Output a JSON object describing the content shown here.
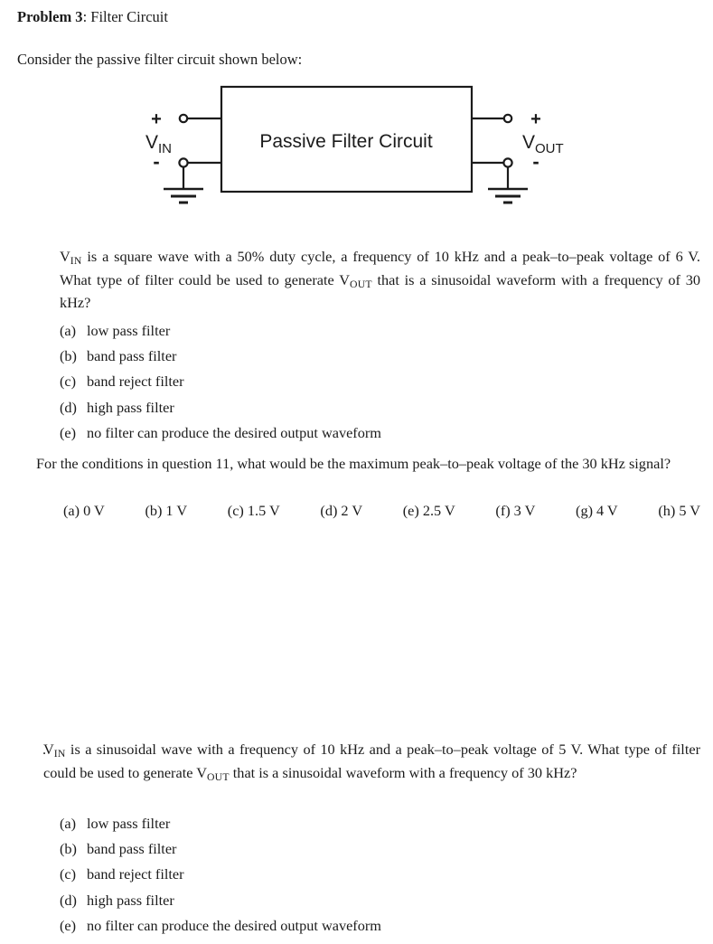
{
  "document": {
    "heading": {
      "bold_part": "Problem 3",
      "rest": ": Filter Circuit"
    },
    "intro": "Consider the passive filter circuit shown below:"
  },
  "diagram": {
    "box_label": "Passive Filter Circuit",
    "input": {
      "plus": "+",
      "minus": "-",
      "name_main": "V",
      "name_sub": "IN"
    },
    "output": {
      "plus": "+",
      "minus": "-",
      "name_main": "V",
      "name_sub": "OUT"
    },
    "colors": {
      "line": "#1b1b1b",
      "fill": "#ffffff"
    }
  },
  "questions": [
    {
      "marker": "",
      "text_parts": {
        "p1_a": "V",
        "p1_sub": "IN",
        "p1_b": " is a square wave with a 50% duty cycle, a frequency of 10 kHz and a peak–to–peak voltage of 6 V. What type of filter could be used to generate ",
        "p1_c": "V",
        "p1_sub2": "OUT",
        "p1_d": " that is a sinusoidal waveform with a frequency of 30 kHz?"
      },
      "choices": [
        {
          "label": "(a)",
          "text": "low pass filter"
        },
        {
          "label": "(b)",
          "text": "band pass filter"
        },
        {
          "label": "(c)",
          "text": "band reject filter"
        },
        {
          "label": "(d)",
          "text": "high pass filter"
        },
        {
          "label": "(e)",
          "text": "no filter can produce the desired output waveform"
        }
      ]
    },
    {
      "marker": "",
      "text": "For the conditions in question 11, what would be the maximum peak–to–peak voltage of the 30 kHz signal?",
      "inline_choices": [
        {
          "label": "(a)",
          "text": "0 V"
        },
        {
          "label": "(b)",
          "text": "1 V"
        },
        {
          "label": "(c)",
          "text": "1.5 V"
        },
        {
          "label": "(d)",
          "text": "2 V"
        },
        {
          "label": "(e)",
          "text": "2.5 V"
        },
        {
          "label": "(f)",
          "text": "3 V"
        },
        {
          "label": "(g)",
          "text": "4 V"
        },
        {
          "label": "(h)",
          "text": "5 V"
        }
      ]
    },
    {
      "marker": ".",
      "text_parts": {
        "p3_a": "V",
        "p3_sub": "IN",
        "p3_b": " is a sinusoidal wave with a frequency of 10 kHz and a peak–to–peak voltage of 5 V. What type of filter could be used to generate ",
        "p3_c": "V",
        "p3_sub2": "OUT",
        "p3_d": " that is a sinusoidal waveform with a frequency of 30 kHz?"
      },
      "choices": [
        {
          "label": "(a)",
          "text": "low pass filter"
        },
        {
          "label": "(b)",
          "text": "band pass filter"
        },
        {
          "label": "(c)",
          "text": "band reject filter"
        },
        {
          "label": "(d)",
          "text": "high pass filter"
        },
        {
          "label": "(e)",
          "text": "no filter can produce the desired output waveform"
        }
      ]
    }
  ]
}
